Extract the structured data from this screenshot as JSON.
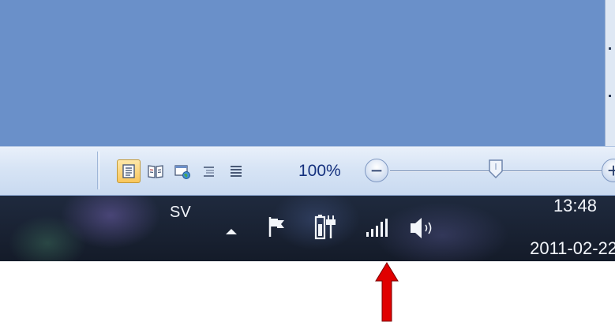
{
  "statusbar": {
    "view_buttons": [
      {
        "icon": "print-layout-icon",
        "active": true
      },
      {
        "icon": "full-screen-reading-icon",
        "active": false
      },
      {
        "icon": "web-layout-icon",
        "active": false
      },
      {
        "icon": "outline-icon",
        "active": false
      },
      {
        "icon": "draft-icon",
        "active": false
      }
    ],
    "zoom": {
      "level_label": "100%",
      "decrease_symbol": "−",
      "increase_symbol": "+",
      "slider_position": 0.5
    }
  },
  "taskbar": {
    "language": "SV",
    "tray_icons": [
      "show-hidden-icons-arrow-icon",
      "action-center-flag-icon",
      "battery-power-icon",
      "signal-strength-icon",
      "volume-icon"
    ],
    "clock": {
      "time": "13:48",
      "date": "2011-02-22"
    }
  },
  "annotation": {
    "arrow_color": "#e00000",
    "points_to": "signal-strength-icon"
  },
  "colors": {
    "document_background": "#6a90c9",
    "zoom_text": "#15317e",
    "active_view_button": "#f9c65b"
  }
}
